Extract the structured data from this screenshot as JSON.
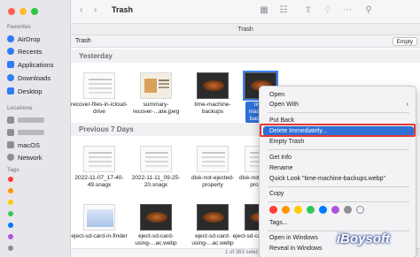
{
  "window": {
    "title": "Trash",
    "tab": "Trash"
  },
  "pathbar": {
    "label": "Trash",
    "empty_button": "Empty"
  },
  "sidebar": {
    "favorites_header": "Favorites",
    "favorites": [
      {
        "label": "AirDrop",
        "icon": "airdrop-icon"
      },
      {
        "label": "Recents",
        "icon": "clock-icon"
      },
      {
        "label": "Applications",
        "icon": "applications-icon"
      },
      {
        "label": "Downloads",
        "icon": "download-icon"
      },
      {
        "label": "Desktop",
        "icon": "desktop-icon"
      }
    ],
    "locations_header": "Locations",
    "locations": [
      {
        "label": "",
        "icon": "computer-icon"
      },
      {
        "label": "",
        "icon": "disk-icon"
      },
      {
        "label": "macOS",
        "icon": "disk-icon"
      },
      {
        "label": "Network",
        "icon": "network-icon"
      }
    ],
    "tags_header": "Tags",
    "tag_colors": [
      "#ff3b30",
      "#ff9500",
      "#ffcc00",
      "#34c759",
      "#007aff",
      "#af52de",
      "#8e8e93"
    ]
  },
  "sections": {
    "yesterday": "Yesterday",
    "previous7": "Previous 7 Days"
  },
  "files_yesterday": [
    "recover-files-in-icloud-drive",
    "summary-recover-...ate.jpeg",
    "time-machine-backups",
    "time-machine-backups"
  ],
  "files_previous": [
    "2022-11-07_17-40-49.snagx",
    "2022-11-11_09-25-20.snagx",
    "disk-not-ejected-properly",
    "disk-not-ejected-properly"
  ],
  "files_third_row": [
    "eject-sd-card-in-finder",
    "eject-sd-card-using-...ac.webp",
    "eject-sd-card-using-...ac.webp",
    "eject-sd-card-using-..."
  ],
  "status": "1 of 363 selected",
  "context_menu": {
    "open": "Open",
    "open_with": "Open With",
    "put_back": "Put Back",
    "delete_immediately": "Delete Immediately...",
    "empty_trash": "Empty Trash",
    "get_info": "Get Info",
    "rename": "Rename",
    "quick_look": "Quick Look \"time-machine-backups.webp\"",
    "copy": "Copy",
    "tags": "Tags...",
    "open_in_windows": "Open in Windows",
    "reveal_in_windows": "Reveal in Windows",
    "tag_colors": [
      "#ff3b30",
      "#ff9500",
      "#ffcc00",
      "#34c759",
      "#007aff",
      "#af52de",
      "#8e8e93",
      "empty"
    ]
  },
  "watermark": "iBoysoft"
}
